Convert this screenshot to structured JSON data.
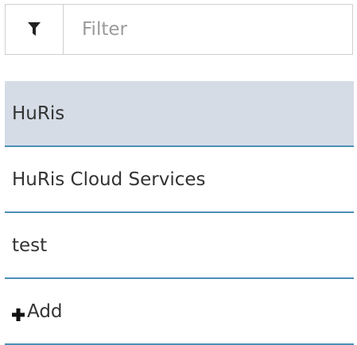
{
  "filter": {
    "icon": "filter-icon",
    "placeholder": "Filter",
    "value": ""
  },
  "list": {
    "items": [
      {
        "label": "HuRis",
        "selected": true
      },
      {
        "label": "HuRis Cloud Services",
        "selected": false
      },
      {
        "label": "test",
        "selected": false
      }
    ],
    "add_label": "Add",
    "add_icon": "plus-icon"
  },
  "colors": {
    "selected_bg": "#d5dce6",
    "divider": "#4a90b8",
    "border": "#cfcfcf",
    "text": "#333333",
    "placeholder": "#9a9a9a"
  }
}
